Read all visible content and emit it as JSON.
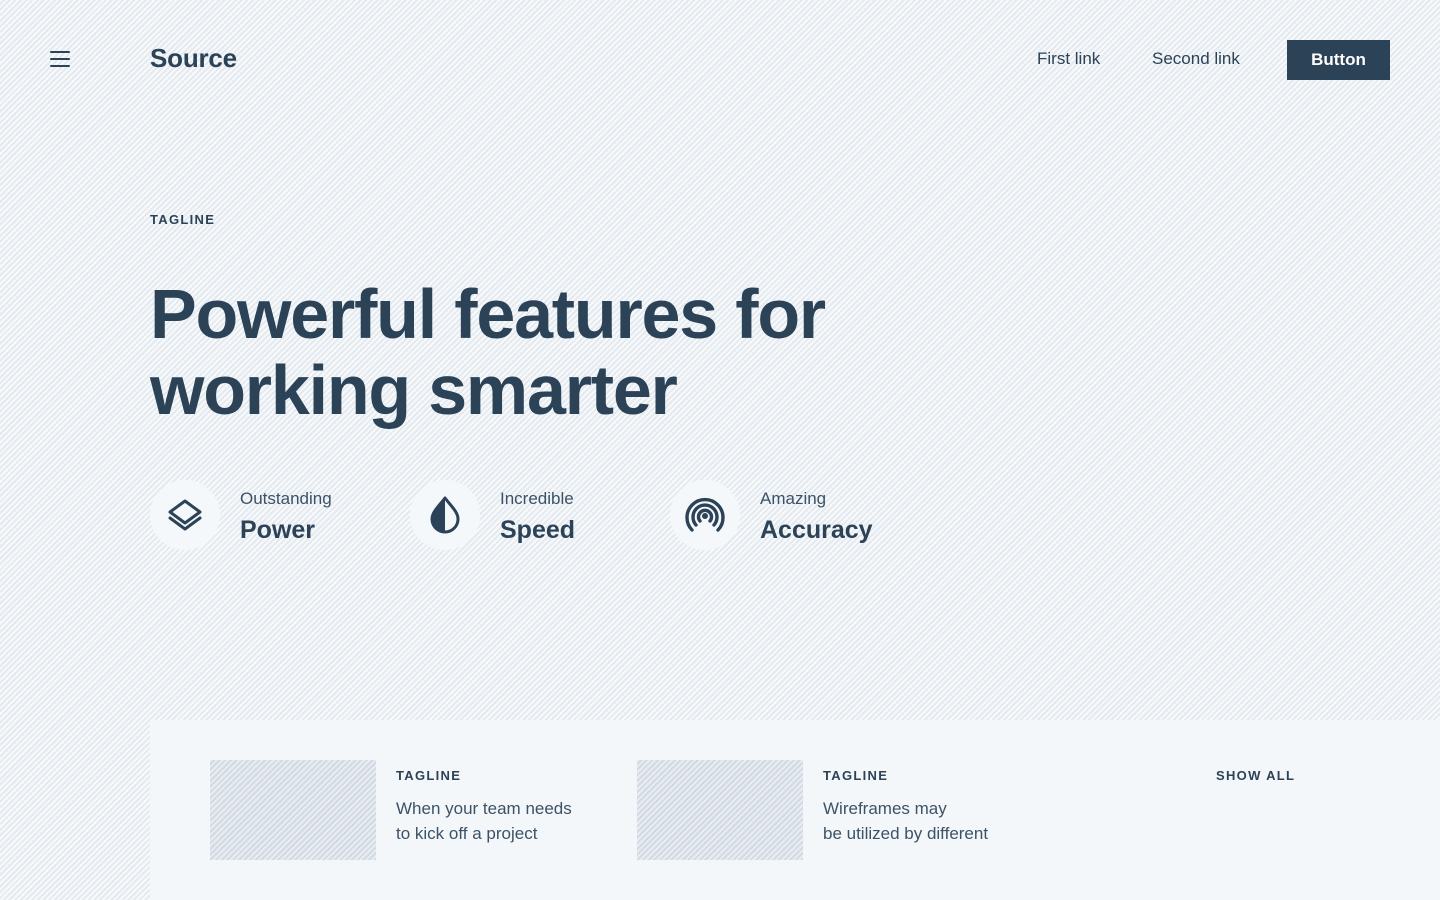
{
  "header": {
    "logo": "Source",
    "links": [
      "First link",
      "Second link"
    ],
    "button_label": "Button"
  },
  "hero": {
    "tagline": "TAGLINE",
    "headline_line1": "Powerful features for",
    "headline_line2": "working smarter"
  },
  "features": [
    {
      "small": "Outstanding",
      "big": "Power",
      "icon": "layers-icon"
    },
    {
      "small": "Incredible",
      "big": "Speed",
      "icon": "droplet-icon"
    },
    {
      "small": "Amazing",
      "big": "Accuracy",
      "icon": "signal-icon"
    }
  ],
  "cards": [
    {
      "tagline": "TAGLINE",
      "text_line1": "When your team needs",
      "text_line2": "to kick off a project"
    },
    {
      "tagline": "TAGLINE",
      "text_line1": "Wireframes may",
      "text_line2": "be utilized by different"
    }
  ],
  "show_all": "SHOW ALL",
  "colors": {
    "primary": "#2b4257",
    "background": "#eef2f6",
    "panel": "#f3f7fa",
    "icon_circle": "#f5f8fb"
  }
}
